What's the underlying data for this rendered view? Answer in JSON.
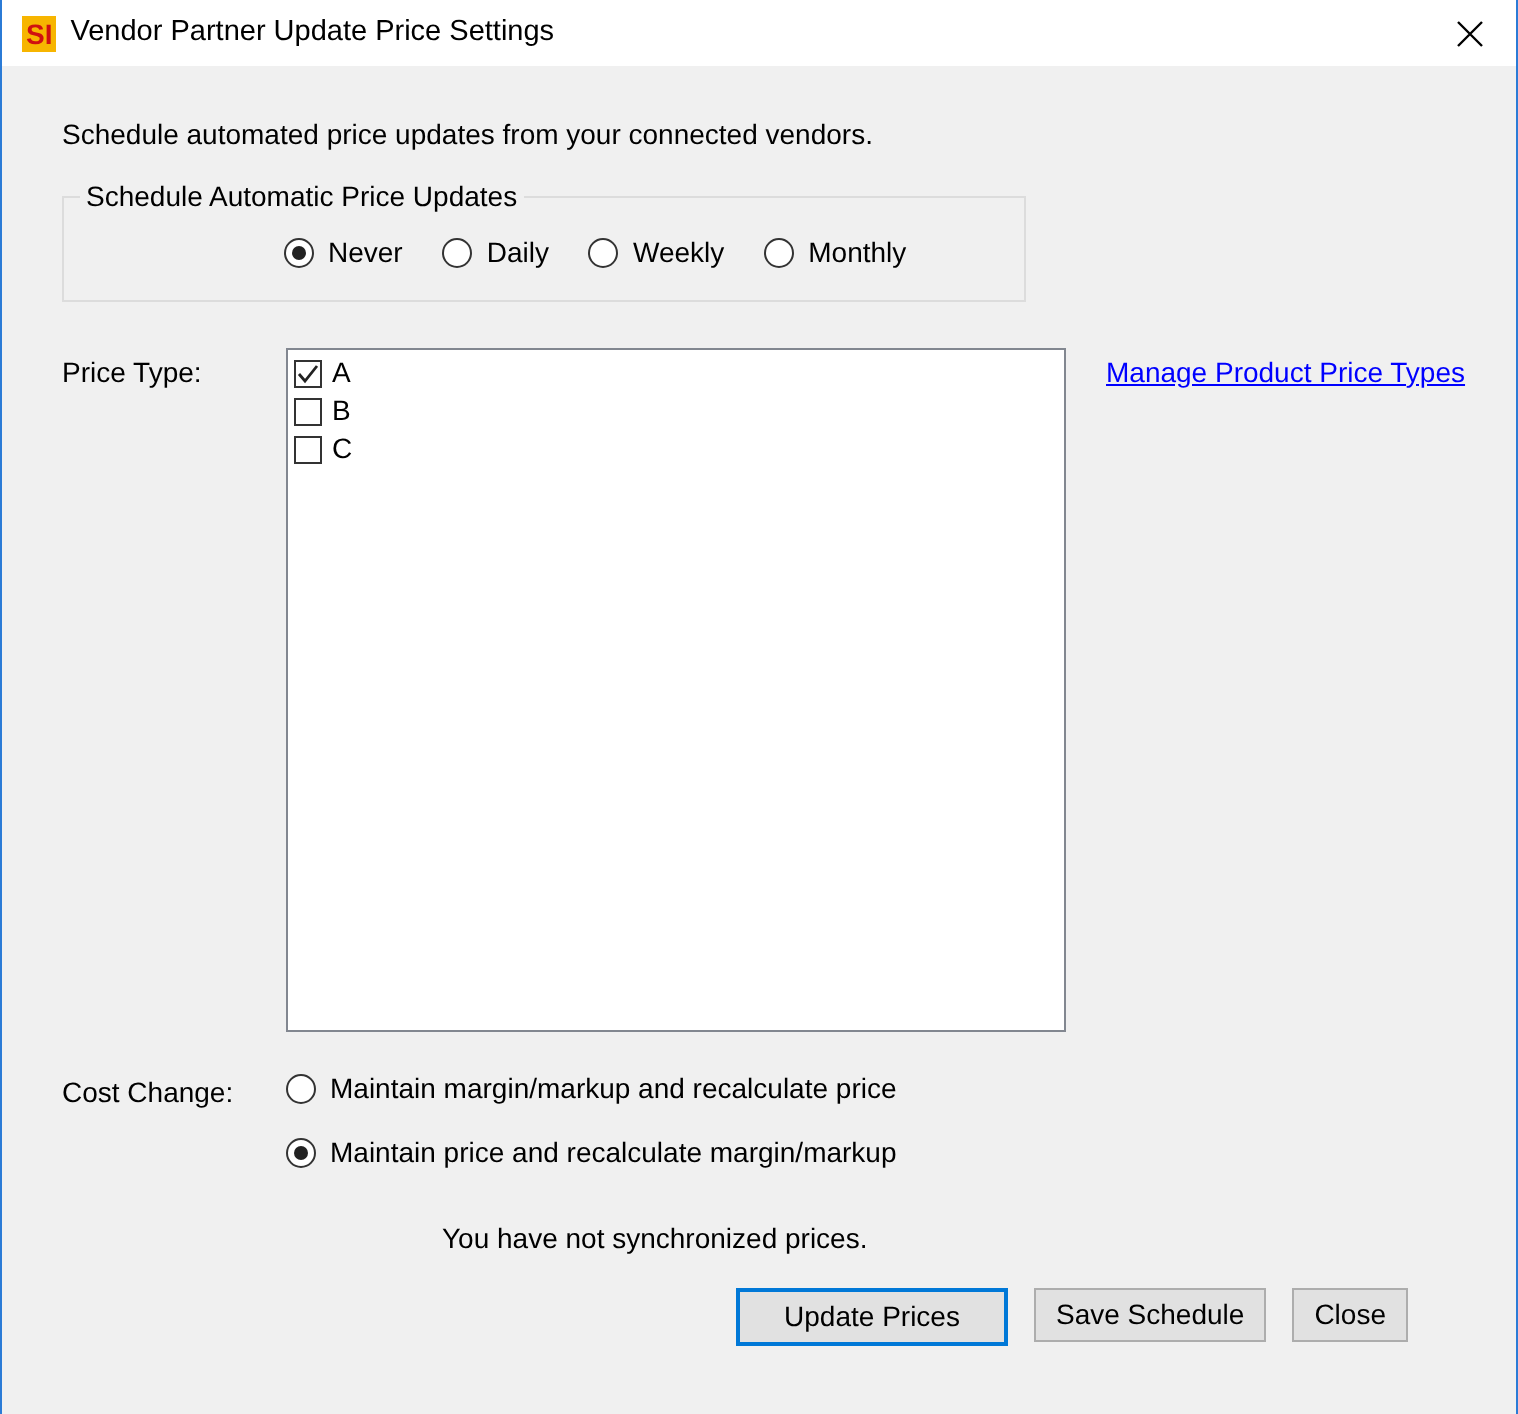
{
  "window": {
    "title": "Vendor Partner Update Price Settings",
    "app_icon": "SI"
  },
  "intro": "Schedule automated price updates from your connected vendors.",
  "schedule": {
    "title": "Schedule Automatic Price Updates",
    "options": [
      {
        "label": "Never",
        "selected": true
      },
      {
        "label": "Daily",
        "selected": false
      },
      {
        "label": "Weekly",
        "selected": false
      },
      {
        "label": "Monthly",
        "selected": false
      }
    ]
  },
  "price_type": {
    "label": "Price Type:",
    "items": [
      {
        "label": "A",
        "checked": true
      },
      {
        "label": "B",
        "checked": false
      },
      {
        "label": "C",
        "checked": false
      }
    ],
    "link": "Manage Product Price Types"
  },
  "cost_change": {
    "label": "Cost Change:",
    "options": [
      {
        "label": "Maintain margin/markup and recalculate price",
        "selected": false
      },
      {
        "label": "Maintain price and recalculate margin/markup",
        "selected": true
      }
    ]
  },
  "status": "You have not synchronized prices.",
  "buttons": [
    {
      "label": "Update Prices",
      "focused": true
    },
    {
      "label": "Save Schedule",
      "focused": false
    },
    {
      "label": "Close",
      "focused": false
    }
  ]
}
